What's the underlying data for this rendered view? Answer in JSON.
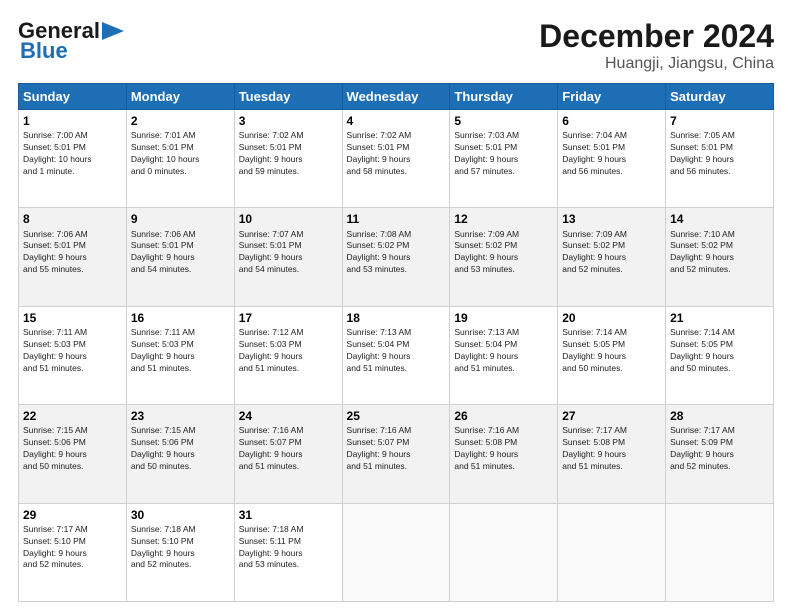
{
  "header": {
    "logo_line1": "General",
    "logo_line2": "Blue",
    "month": "December 2024",
    "location": "Huangji, Jiangsu, China"
  },
  "weekdays": [
    "Sunday",
    "Monday",
    "Tuesday",
    "Wednesday",
    "Thursday",
    "Friday",
    "Saturday"
  ],
  "weeks": [
    [
      {
        "day": "1",
        "info": "Sunrise: 7:00 AM\nSunset: 5:01 PM\nDaylight: 10 hours\nand 1 minute."
      },
      {
        "day": "2",
        "info": "Sunrise: 7:01 AM\nSunset: 5:01 PM\nDaylight: 10 hours\nand 0 minutes."
      },
      {
        "day": "3",
        "info": "Sunrise: 7:02 AM\nSunset: 5:01 PM\nDaylight: 9 hours\nand 59 minutes."
      },
      {
        "day": "4",
        "info": "Sunrise: 7:02 AM\nSunset: 5:01 PM\nDaylight: 9 hours\nand 58 minutes."
      },
      {
        "day": "5",
        "info": "Sunrise: 7:03 AM\nSunset: 5:01 PM\nDaylight: 9 hours\nand 57 minutes."
      },
      {
        "day": "6",
        "info": "Sunrise: 7:04 AM\nSunset: 5:01 PM\nDaylight: 9 hours\nand 56 minutes."
      },
      {
        "day": "7",
        "info": "Sunrise: 7:05 AM\nSunset: 5:01 PM\nDaylight: 9 hours\nand 56 minutes."
      }
    ],
    [
      {
        "day": "8",
        "info": "Sunrise: 7:06 AM\nSunset: 5:01 PM\nDaylight: 9 hours\nand 55 minutes."
      },
      {
        "day": "9",
        "info": "Sunrise: 7:06 AM\nSunset: 5:01 PM\nDaylight: 9 hours\nand 54 minutes."
      },
      {
        "day": "10",
        "info": "Sunrise: 7:07 AM\nSunset: 5:01 PM\nDaylight: 9 hours\nand 54 minutes."
      },
      {
        "day": "11",
        "info": "Sunrise: 7:08 AM\nSunset: 5:02 PM\nDaylight: 9 hours\nand 53 minutes."
      },
      {
        "day": "12",
        "info": "Sunrise: 7:09 AM\nSunset: 5:02 PM\nDaylight: 9 hours\nand 53 minutes."
      },
      {
        "day": "13",
        "info": "Sunrise: 7:09 AM\nSunset: 5:02 PM\nDaylight: 9 hours\nand 52 minutes."
      },
      {
        "day": "14",
        "info": "Sunrise: 7:10 AM\nSunset: 5:02 PM\nDaylight: 9 hours\nand 52 minutes."
      }
    ],
    [
      {
        "day": "15",
        "info": "Sunrise: 7:11 AM\nSunset: 5:03 PM\nDaylight: 9 hours\nand 51 minutes."
      },
      {
        "day": "16",
        "info": "Sunrise: 7:11 AM\nSunset: 5:03 PM\nDaylight: 9 hours\nand 51 minutes."
      },
      {
        "day": "17",
        "info": "Sunrise: 7:12 AM\nSunset: 5:03 PM\nDaylight: 9 hours\nand 51 minutes."
      },
      {
        "day": "18",
        "info": "Sunrise: 7:13 AM\nSunset: 5:04 PM\nDaylight: 9 hours\nand 51 minutes."
      },
      {
        "day": "19",
        "info": "Sunrise: 7:13 AM\nSunset: 5:04 PM\nDaylight: 9 hours\nand 51 minutes."
      },
      {
        "day": "20",
        "info": "Sunrise: 7:14 AM\nSunset: 5:05 PM\nDaylight: 9 hours\nand 50 minutes."
      },
      {
        "day": "21",
        "info": "Sunrise: 7:14 AM\nSunset: 5:05 PM\nDaylight: 9 hours\nand 50 minutes."
      }
    ],
    [
      {
        "day": "22",
        "info": "Sunrise: 7:15 AM\nSunset: 5:06 PM\nDaylight: 9 hours\nand 50 minutes."
      },
      {
        "day": "23",
        "info": "Sunrise: 7:15 AM\nSunset: 5:06 PM\nDaylight: 9 hours\nand 50 minutes."
      },
      {
        "day": "24",
        "info": "Sunrise: 7:16 AM\nSunset: 5:07 PM\nDaylight: 9 hours\nand 51 minutes."
      },
      {
        "day": "25",
        "info": "Sunrise: 7:16 AM\nSunset: 5:07 PM\nDaylight: 9 hours\nand 51 minutes."
      },
      {
        "day": "26",
        "info": "Sunrise: 7:16 AM\nSunset: 5:08 PM\nDaylight: 9 hours\nand 51 minutes."
      },
      {
        "day": "27",
        "info": "Sunrise: 7:17 AM\nSunset: 5:08 PM\nDaylight: 9 hours\nand 51 minutes."
      },
      {
        "day": "28",
        "info": "Sunrise: 7:17 AM\nSunset: 5:09 PM\nDaylight: 9 hours\nand 52 minutes."
      }
    ],
    [
      {
        "day": "29",
        "info": "Sunrise: 7:17 AM\nSunset: 5:10 PM\nDaylight: 9 hours\nand 52 minutes."
      },
      {
        "day": "30",
        "info": "Sunrise: 7:18 AM\nSunset: 5:10 PM\nDaylight: 9 hours\nand 52 minutes."
      },
      {
        "day": "31",
        "info": "Sunrise: 7:18 AM\nSunset: 5:11 PM\nDaylight: 9 hours\nand 53 minutes."
      },
      {
        "day": "",
        "info": ""
      },
      {
        "day": "",
        "info": ""
      },
      {
        "day": "",
        "info": ""
      },
      {
        "day": "",
        "info": ""
      }
    ]
  ]
}
